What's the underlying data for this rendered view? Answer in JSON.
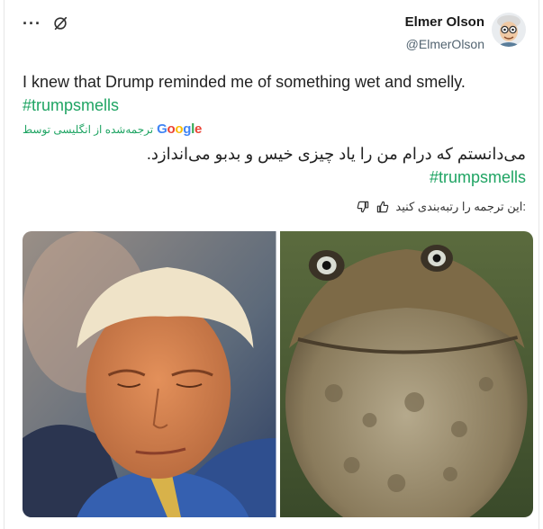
{
  "post": {
    "author_name": "Elmer Olson",
    "author_handle": "@ElmerOlson",
    "text": "I knew that Drump reminded me of something wet and smelly.",
    "hashtag": "#trumpsmells"
  },
  "translation": {
    "google_label": "Google",
    "translated_by": "ترجمه‌شده از انگلیسی توسط",
    "text": "می‌دانستم که درام من را یاد چیزی خیس و بدبو می‌اندازد.",
    "hashtag": "#trumpsmells",
    "rate_prompt": ":این ترجمه را رتبه‌بندی کنید"
  },
  "actions": {
    "more": "···"
  },
  "icons": {
    "more": "more-dots-icon",
    "not_interested": "not-interested-icon",
    "thumb_up": "thumb-up-icon",
    "thumb_down": "thumb-down-icon"
  },
  "colors": {
    "hashtag": "#1fa463",
    "handle": "#536471",
    "google_blue": "#4285f4",
    "google_red": "#ea4335",
    "google_yellow": "#fbbc05",
    "google_green": "#34a853"
  }
}
